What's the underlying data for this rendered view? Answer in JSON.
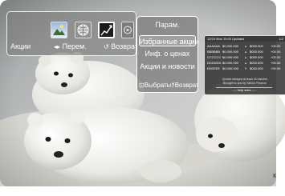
{
  "widget_bar": {
    "icons": [
      "photo-icon",
      "globe-icon",
      "stocks-chart-icon",
      "news-icon"
    ],
    "stocks_label": "Акции",
    "move_symbol": "◂▸",
    "move_label": "Перем.",
    "back_symbol": "↺",
    "back_label": "Возврат"
  },
  "settings_menu": {
    "title": "Парам.",
    "items": [
      {
        "label": "Избранные акции",
        "selected": true
      },
      {
        "label": "Инф. о ценах",
        "selected": false
      },
      {
        "label": "Акции и новости",
        "selected": false
      }
    ],
    "select_symbol": "⊡",
    "select_label": "Выбрать",
    "back_symbol": "↺",
    "back_label": "Возврат"
  },
  "ticker": {
    "timestamp": "12/24 Mon 15:00 Updated",
    "page": "1/2",
    "rows": [
      {
        "symbol": "AAAAAA",
        "price": "$0.000.000",
        "direction": "up",
        "change": "$000.000",
        "percent": "+00.00"
      },
      {
        "symbol": "BBBBBB",
        "price": "$0.000.000",
        "direction": "up",
        "change": "$000.000",
        "percent": "+00.00"
      },
      {
        "symbol": "CCCCCC",
        "price": "$0.000.000",
        "direction": "up",
        "change": "$000.000",
        "percent": "+00.00"
      },
      {
        "symbol": "DDDDDD",
        "price": "$0.000.000",
        "direction": "up",
        "change": "$000.000",
        "percent": "+00.00"
      },
      {
        "symbol": "EEEEEE",
        "price": "$0.000.000",
        "direction": "down",
        "change": "$000.000",
        "percent": "+00.00"
      }
    ],
    "note_line1": "Quotes delayed at least 15 minutes",
    "note_line2": "Brought to you by Yahoo! Finance",
    "help": "---- help area ----"
  },
  "colors": {
    "panel_fill": "#7d7d7d",
    "panel_border": "#ffffff",
    "ticker_fill": "#282828",
    "text": "#ffffff"
  }
}
